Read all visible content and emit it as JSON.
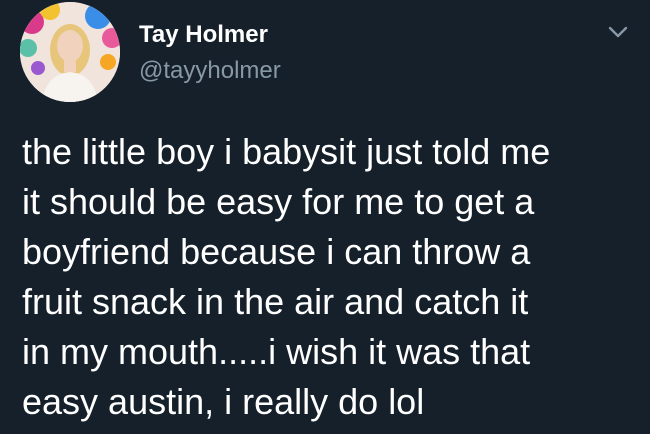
{
  "author": {
    "display_name": "Tay Holmer",
    "handle": "@tayyholmer"
  },
  "menu_icon": "chevron-down-icon",
  "tweet": {
    "lines": [
      "the little boy i babysit just told me",
      "it should be easy for me to get a",
      "boyfriend because i can throw a",
      "fruit snack in the air and catch it",
      "in my mouth.....i wish it was that",
      "easy austin, i really do lol"
    ]
  },
  "colors": {
    "background": "#15202b",
    "text": "#ffffff",
    "secondary_text": "#8899a6"
  }
}
